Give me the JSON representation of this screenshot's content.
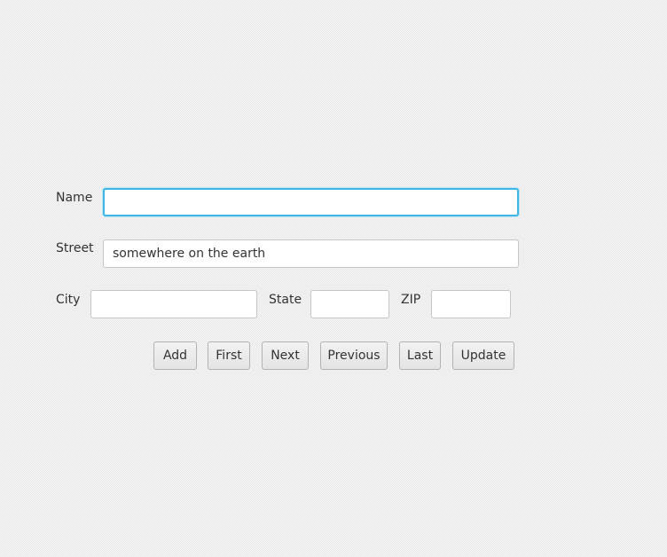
{
  "form": {
    "name_label": "Name",
    "name_value": "",
    "street_label": "Street",
    "street_value": "somewhere on the earth",
    "city_label": "City",
    "city_value": "",
    "state_label": "State",
    "state_value": "",
    "zip_label": "ZIP",
    "zip_value": ""
  },
  "buttons": {
    "add": "Add",
    "first": "First",
    "next": "Next",
    "previous": "Previous",
    "last": "Last",
    "update": "Update"
  },
  "colors": {
    "focus_ring": "#3fb6e6",
    "button_top": "#f2f2f2",
    "button_bottom": "#e4e4e4"
  }
}
